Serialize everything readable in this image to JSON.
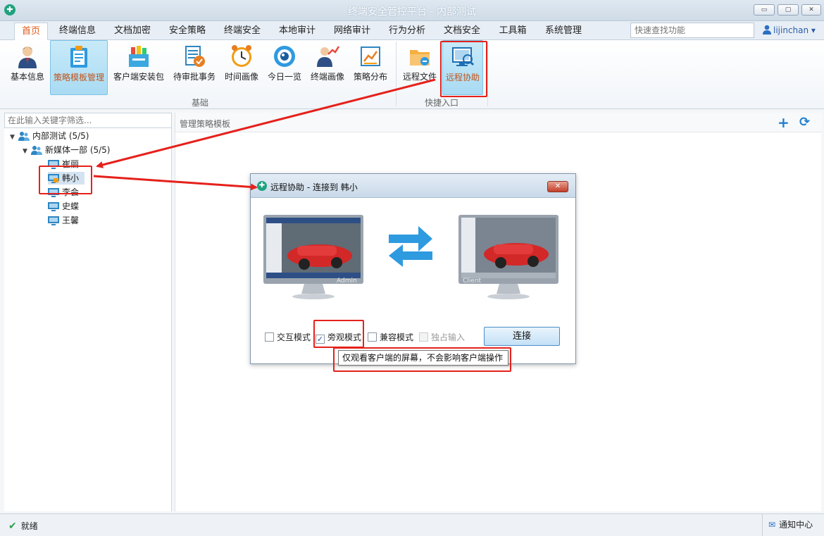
{
  "window": {
    "title": "终端安全管控平台 - 内部测试",
    "controls": [
      "▭",
      "▢",
      "✕"
    ]
  },
  "menu": {
    "tabs": [
      "首页",
      "终端信息",
      "文档加密",
      "安全策略",
      "终端安全",
      "本地审计",
      "网络审计",
      "行为分析",
      "文档安全",
      "工具箱",
      "系统管理"
    ],
    "active_tab": "首页",
    "search_placeholder": "快速查找功能",
    "user": "lijinchan ▾"
  },
  "ribbon": {
    "buttons": [
      "基本信息",
      "策略模板管理",
      "客户端安装包",
      "待审批事务",
      "时间画像",
      "今日一览",
      "终端画像",
      "策略分布",
      "远程文件",
      "远程协助"
    ],
    "groups": [
      "基础",
      "快捷入口"
    ]
  },
  "left": {
    "filter_placeholder": "在此输入关键字筛选...",
    "tree": {
      "root": "内部测试 (5/5)",
      "dept": "新媒体一部 (5/5)",
      "users": [
        "崔丽",
        "韩小",
        "李会",
        "史蝶",
        "王馨"
      ]
    }
  },
  "right": {
    "header": "管理策略模板",
    "add_glyph": "+",
    "refresh_glyph": "⟳"
  },
  "dialog": {
    "title": "远程协助 - 连接到 韩小",
    "close": "✕",
    "monitor_left_label": "Admin",
    "monitor_right_label": "Client",
    "options": [
      {
        "label": "交互模式",
        "checked": false,
        "disabled": false
      },
      {
        "label": "旁观模式",
        "checked": true,
        "disabled": false
      },
      {
        "label": "兼容模式",
        "checked": false,
        "disabled": false
      },
      {
        "label": "独占输入",
        "checked": false,
        "disabled": true
      }
    ],
    "connect_label": "连接",
    "tooltip": "仅观看客户端的屏幕，不会影响客户端操作"
  },
  "status": {
    "text": "就绪",
    "notice": "通知中心"
  },
  "colors": {
    "accent": "#e05a1a",
    "highlight": "#e5211b",
    "link": "#1f7fd0"
  }
}
